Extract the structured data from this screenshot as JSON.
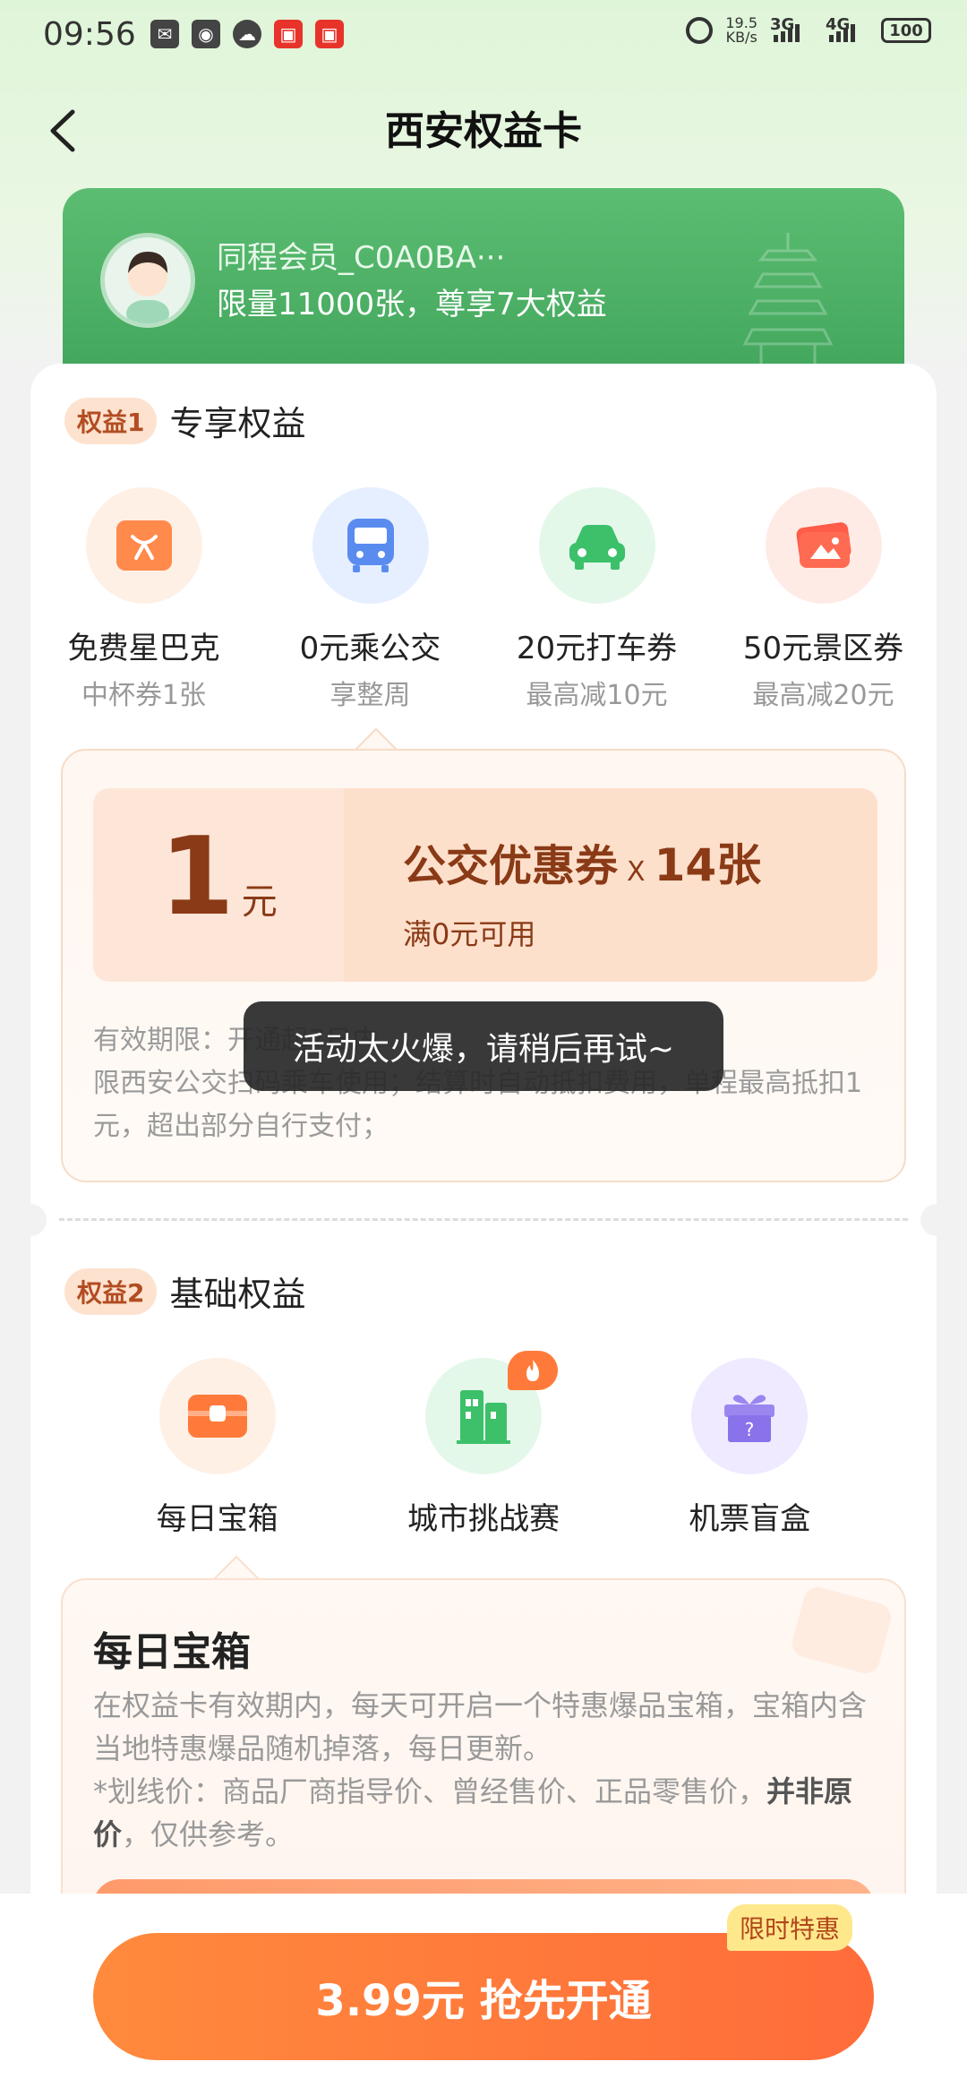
{
  "status_bar": {
    "time": "09:56",
    "net_speed_value": "19.5",
    "net_speed_unit": "KB/s",
    "sim1": "3G",
    "sim2": "4G",
    "battery": "100"
  },
  "header": {
    "title": "西安权益卡"
  },
  "member": {
    "name": "同程会员_C0A0BA···",
    "description": "限量11000张，尊享7大权益"
  },
  "section1": {
    "badge": "权益1",
    "title": "专享权益",
    "items": [
      {
        "name": "免费星巴克",
        "sub": "中杯券1张"
      },
      {
        "name": "0元乘公交",
        "sub": "享整周"
      },
      {
        "name": "20元打车券",
        "sub": "最高减10元"
      },
      {
        "name": "50元景区券",
        "sub": "最高减20元"
      }
    ]
  },
  "coupon": {
    "amount": "1",
    "unit": "元",
    "title": "公交优惠券",
    "multiplier": "X",
    "count": "14张",
    "condition": "满0元可用",
    "validity": "有效期限：开通起7日内",
    "note": "限西安公交扫码乘车使用；结算时自动抵扣费用，单程最高抵扣1元，超出部分自行支付；"
  },
  "toast": {
    "text": "活动太火爆，请稍后再试~"
  },
  "section2": {
    "badge": "权益2",
    "title": "基础权益",
    "items": [
      {
        "name": "每日宝箱"
      },
      {
        "name": "城市挑战赛"
      },
      {
        "name": "机票盲盒"
      }
    ]
  },
  "daily_box": {
    "title": "每日宝箱",
    "text1": "在权益卡有效期内，每天可开启一个特惠爆品宝箱，宝箱内含当地特惠爆品随机掉落，每日更新。",
    "text2_a": "*划线价：商品厂商指导价、曾经售价、正品零售价，",
    "text2_bold": "并非原价",
    "text2_b": "，仅供参考。"
  },
  "cta": {
    "label": "3.99元 抢先开通",
    "tag": "限时特惠"
  },
  "colors": {
    "green": "#4caf63",
    "orange": "#ff7a3a",
    "coupon_brown": "#8a3a16"
  }
}
